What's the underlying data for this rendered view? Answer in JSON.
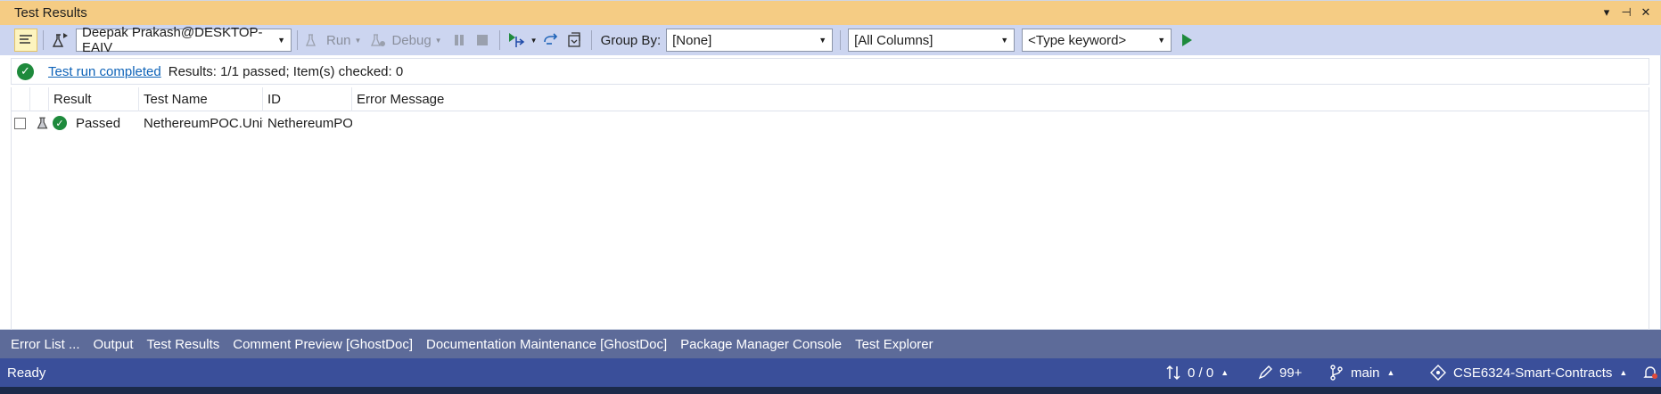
{
  "panel": {
    "title": "Test Results",
    "controls": [
      "▾",
      "⊣",
      "✕"
    ]
  },
  "toolbar": {
    "run_source": "Deepak Prakash@DESKTOP-EAIV",
    "run_label": "Run",
    "debug_label": "Debug",
    "group_by_label": "Group By:",
    "group_by_value": "[None]",
    "columns_value": "[All Columns]",
    "keyword_placeholder": "<Type keyword>"
  },
  "summary": {
    "link": "Test run completed",
    "text": "Results: 1/1 passed;  Item(s) checked: 0"
  },
  "table": {
    "headers": [
      "Result",
      "Test Name",
      "ID",
      "Error Message"
    ],
    "rows": [
      {
        "result": "Passed",
        "test_name": "NethereumPOC.UnitTests",
        "id": "NethereumPOC",
        "error": ""
      }
    ]
  },
  "tabs": [
    "Error List ...",
    "Output",
    "Test Results",
    "Comment Preview [GhostDoc]",
    "Documentation Maintenance [GhostDoc]",
    "Package Manager Console",
    "Test Explorer"
  ],
  "statusbar": {
    "ready": "Ready",
    "changes": "0 / 0",
    "edits": "99+",
    "branch": "main",
    "repo": "CSE6324-Smart-Contracts"
  },
  "colors": {
    "title_bg": "#f5cc84",
    "toolbar_bg": "#ccd5f0",
    "tabs_bg": "#5d6b99",
    "statusbar_bg": "#3a4f9a",
    "pass_green": "#1e8a3c",
    "link_blue": "#0e63b8"
  },
  "icons": [
    "list-icon",
    "flask-run-icon",
    "run-icon",
    "debug-icon",
    "pause-icon",
    "stop-icon",
    "run-tests-icon",
    "refresh-icon",
    "export-icon",
    "go-icon",
    "check-circle-icon",
    "flask-icon",
    "sync-icon",
    "pencil-icon",
    "branch-icon",
    "repo-icon",
    "bell-icon"
  ]
}
